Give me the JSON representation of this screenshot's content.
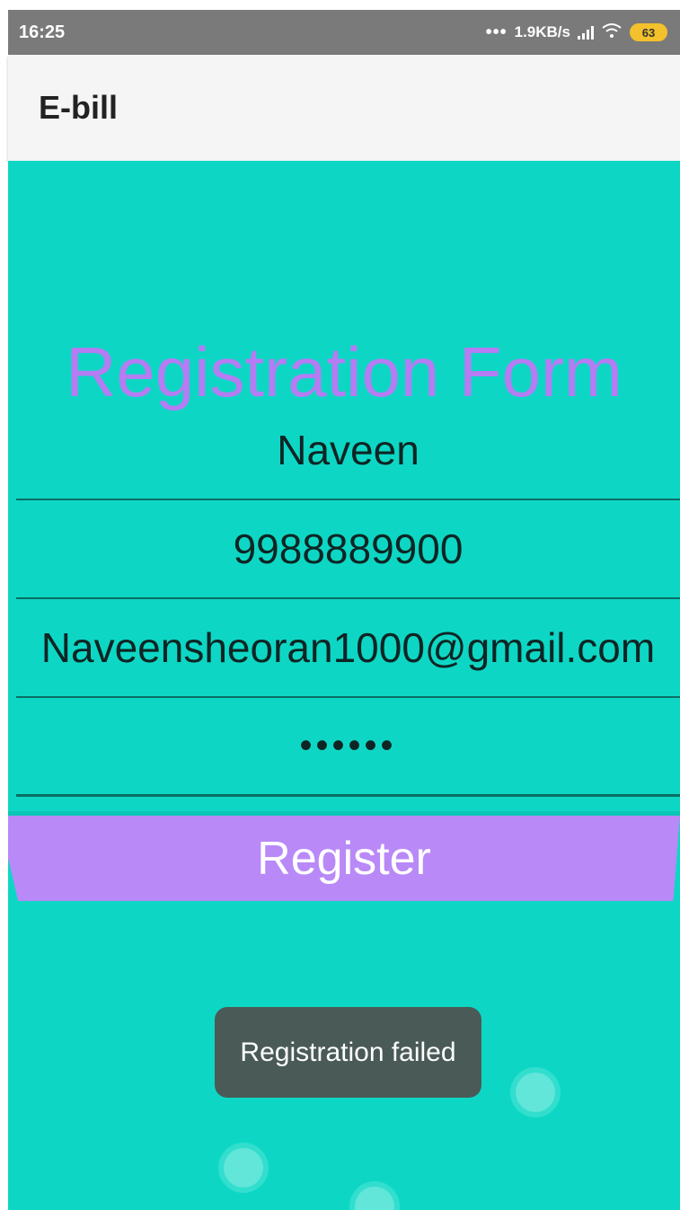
{
  "status_bar": {
    "time": "16:25",
    "dots": "•••",
    "network_speed": "1.9KB/s",
    "battery_level": "63",
    "signal_icon": "signal-bars-icon",
    "wifi_icon": "wifi-icon"
  },
  "app_bar": {
    "title": "E-bill"
  },
  "form": {
    "title": "Registration Form",
    "name_value": "Naveen",
    "phone_value": "9988889900",
    "email_value": "Naveensheoran1000@gmail.com",
    "password_value": "••••••",
    "register_label": "Register"
  },
  "toast": {
    "message": "Registration failed"
  },
  "colors": {
    "background": "#0dd7c4",
    "accent": "#b57cf3",
    "button": "#b989f7",
    "toast": "#4a5b57"
  }
}
